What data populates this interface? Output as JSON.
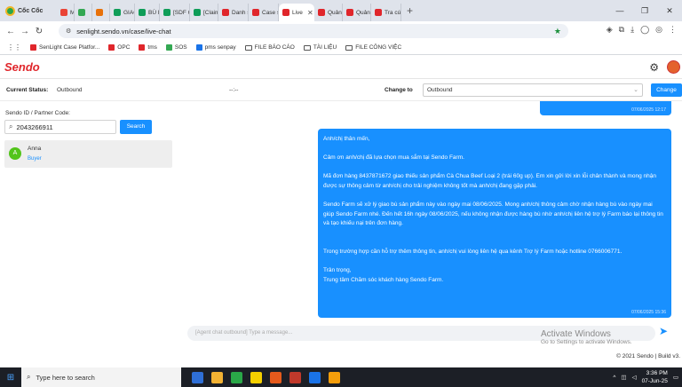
{
  "browser": {
    "brand": "Cốc Cốc",
    "tabs": [
      {
        "label": "M",
        "color": "#ea4335"
      },
      {
        "label": "",
        "color": "#34a853"
      },
      {
        "label": "",
        "color": "#e8710a"
      },
      {
        "label": "GIAO Đ",
        "color": "#0f9d58"
      },
      {
        "label": "BÙ HÀ",
        "color": "#0f9d58"
      },
      {
        "label": "[SDF C",
        "color": "#0f9d58"
      },
      {
        "label": "[Claim",
        "color": "#0f9d58"
      },
      {
        "label": "Danh s",
        "color": "#e0262b"
      },
      {
        "label": "Case sy",
        "color": "#e0262b"
      },
      {
        "label": "Live",
        "color": "#e0262b"
      },
      {
        "label": "Quản L",
        "color": "#e0262b"
      },
      {
        "label": "Quản L",
        "color": "#e0262b"
      },
      {
        "label": "Tra cứu",
        "color": "#e0262b"
      }
    ],
    "url": "senlight.sendo.vn/case/live-chat",
    "bookmarks": [
      {
        "label": "SenLight Case Platfor...",
        "kind": "site",
        "color": "#e0262b"
      },
      {
        "label": "OPC",
        "kind": "site",
        "color": "#e0262b"
      },
      {
        "label": "tms",
        "kind": "site",
        "color": "#e0262b"
      },
      {
        "label": "SOS",
        "kind": "site",
        "color": "#34a853"
      },
      {
        "label": "pms senpay",
        "kind": "site",
        "color": "#1a73e8"
      },
      {
        "label": "FILE BÁO CÁO",
        "kind": "folder"
      },
      {
        "label": "TÀI LIỆU",
        "kind": "folder"
      },
      {
        "label": "FILE CÔNG VIỆC",
        "kind": "folder"
      }
    ]
  },
  "app": {
    "logo": "Sendo",
    "status": {
      "current_label": "Current Status:",
      "current_value": "Outbound",
      "timer": "--:--",
      "change_to_label": "Change to",
      "change_to_value": "Outbound",
      "change_button": "Change"
    },
    "sidebar": {
      "search_label": "Sendo ID / Partner Code:",
      "search_value": "2043266911",
      "search_button": "Search",
      "contact": {
        "initial": "A",
        "name": "Anna",
        "role": "Buyer"
      }
    },
    "chat": {
      "messages": [
        {
          "timestamp": "07/06/2025 12:17"
        },
        {
          "text": "Anh/chị thân mến,\n\nCảm ơn anh/chị đã lựa chọn mua sắm tại Sendo Farm.\n\nMã đơn hàng 8437871672 giao thiếu sản phẩm Cà Chua Beef Loại 2 (trái 60g up). Em xin gửi lời xin lỗi chân thành và mong nhận được sự thông cảm từ anh/chị cho trải nghiệm không tốt mà anh/chị đang gặp phải.\n\nSendo Farm sẽ xử lý giao bù sản phẩm này vào ngày mai 08/06/2025. Mong anh/chị thông cảm chờ nhận hàng bù vào ngày mai giúp Sendo Farm nhé. Đến hết 16h ngày 08/06/2025, nếu không nhận được hàng bù nhờ anh/chị liên hệ trợ lý Farm báo lại thông tin và tạo khiếu nại trên đơn hàng.\n\n\nTrong trường hợp cần hỗ trợ thêm thông tin, anh/chị vui lòng liên hệ qua kênh Trợ lý Farm hoặc hotline 0766006771.\n\nTrân trọng,\nTrung tâm Chăm sóc khách hàng Sendo Farm.",
          "timestamp": "07/06/2025 15:36"
        }
      ],
      "input_placeholder": "[Agent chat outbound] Type a message..."
    },
    "footer": "© 2021 Sendo | Build v3."
  },
  "watermark": {
    "title": "Activate Windows",
    "subtitle": "Go to Settings to activate Windows."
  },
  "taskbar": {
    "search_placeholder": "Type here to search",
    "time": "3:36 PM",
    "date": "07-Jun-25",
    "apps": [
      {
        "color": "#2f6fd6"
      },
      {
        "color": "#f2b233"
      },
      {
        "color": "#2aa748"
      },
      {
        "color": "#f5d000"
      },
      {
        "color": "#e55a1c"
      },
      {
        "color": "#c0392b"
      },
      {
        "color": "#1a73e8"
      },
      {
        "color": "#f59e0b"
      }
    ]
  }
}
